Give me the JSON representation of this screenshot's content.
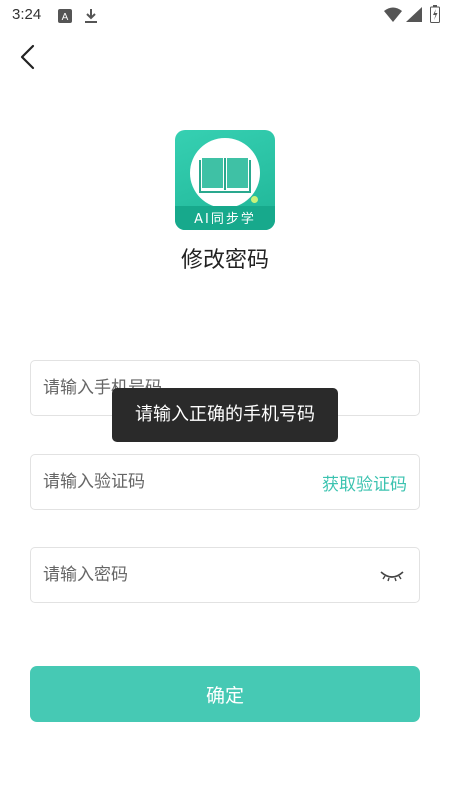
{
  "status_bar": {
    "time": "3:24",
    "icons": [
      "accessibility-icon",
      "download-icon",
      "wifi-icon",
      "signal-icon",
      "battery-icon"
    ]
  },
  "header": {
    "back_icon": "chevron-left-icon"
  },
  "app_logo": {
    "text": "AI同步学",
    "colors": {
      "primary": "#1fb597",
      "accent": "#c9f27a"
    }
  },
  "page": {
    "title": "修改密码"
  },
  "form": {
    "phone": {
      "placeholder": "请输入手机号码",
      "value": ""
    },
    "code": {
      "placeholder": "请输入验证码",
      "value": "",
      "get_code_label": "获取验证码"
    },
    "password": {
      "placeholder": "请输入密码",
      "value": "",
      "toggle_icon": "eye-closed-icon"
    }
  },
  "toast": {
    "message": "请输入正确的手机号码"
  },
  "confirm_button": {
    "label": "确定",
    "color": "#46c9b4"
  },
  "colors": {
    "accent": "#3cc3b0",
    "toast_bg": "#2a2a2a"
  }
}
